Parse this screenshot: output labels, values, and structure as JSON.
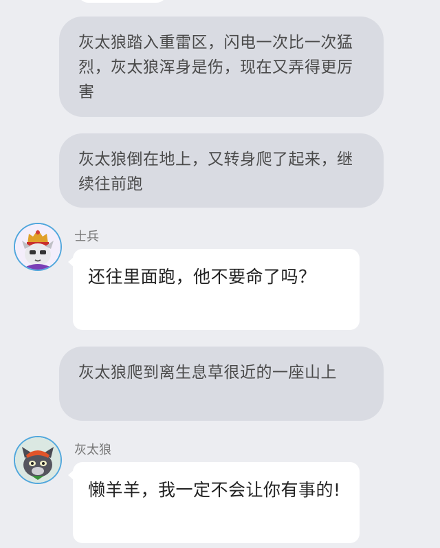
{
  "messages": {
    "narration_1": "灰太狼踏入重雷区，闪电一次比一次猛烈，灰太狼浑身是伤，现在又弄得更厉害",
    "narration_2": "灰太狼倒在地上，又转身爬了起来，继续往前跑",
    "soldier": {
      "name": "士兵",
      "text": "还往里面跑，他不要命了吗？",
      "avatar_icon": "soldier-cat-avatar"
    },
    "narration_3": "灰太狼爬到离生息草很近的一座山上",
    "wolf": {
      "name": "灰太狼",
      "text": "懒羊羊，我一定不会让你有事的!",
      "avatar_icon": "grey-wolf-avatar"
    }
  },
  "colors": {
    "background": "#ecedf1",
    "narration_bubble": "#d9dbe2",
    "message_bubble": "#ffffff",
    "avatar_ring": "#4fa6dc"
  }
}
